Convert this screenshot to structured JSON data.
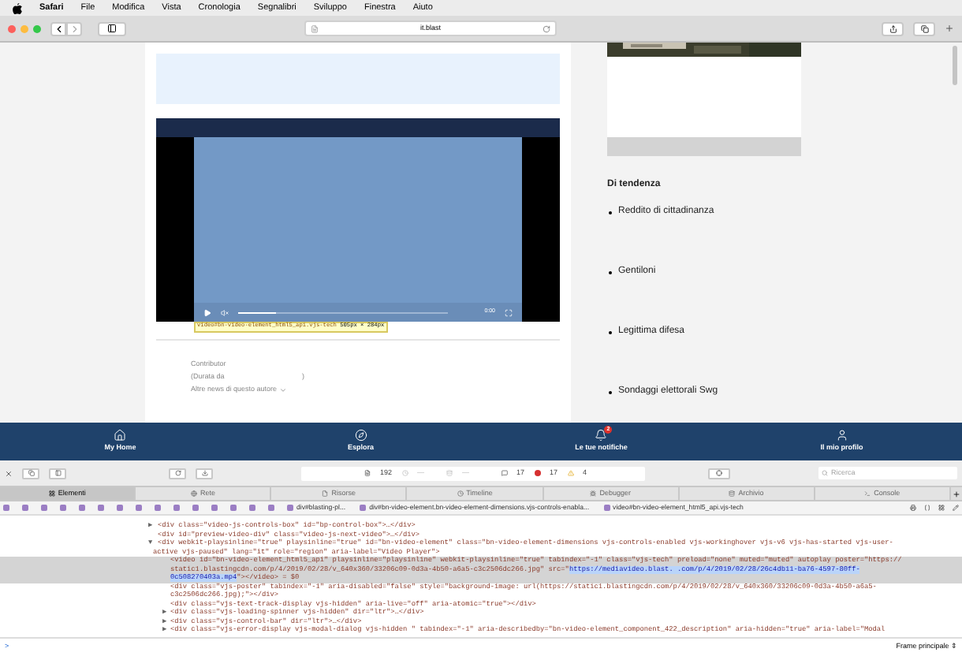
{
  "menu_bar": {
    "app": "Safari",
    "items": [
      "File",
      "Modifica",
      "Vista",
      "Cronologia",
      "Segnalibri",
      "Sviluppo",
      "Finestra",
      "Aiuto"
    ]
  },
  "address_bar": {
    "url": "it.blast"
  },
  "page": {
    "video": {
      "time": "0:00",
      "progress": {
        "level": 0.18
      },
      "inspector_tooltip": {
        "selector": "video#bn-video-element_html5_api.vjs-tech",
        "size": "505px × 284px"
      }
    },
    "author": {
      "label": "Contributor",
      "duration": "(Durata da",
      "duration_end": ")",
      "more": "Altre news di questo autore"
    },
    "trending": {
      "title": "Di tendenza",
      "items": [
        "Reddito di cittadinanza",
        "Gentiloni",
        "Legittima difesa",
        "Sondaggi elettorali Swg"
      ]
    }
  },
  "bottom_nav": [
    {
      "label": "My Home"
    },
    {
      "label": "Esplora"
    },
    {
      "label": "Le tue notifiche",
      "badge": "2"
    },
    {
      "label": "Il mio profilo"
    }
  ],
  "inspector": {
    "toolbar": {
      "resources": "192",
      "load_time": "—",
      "size": "—",
      "messages": "17",
      "errors": "17",
      "warnings": "4",
      "search_placeholder": "Ricerca"
    },
    "tabs": [
      {
        "label": "Elementi",
        "selected": true
      },
      {
        "label": "Rete",
        "selected": false
      },
      {
        "label": "Risorse",
        "selected": false
      },
      {
        "label": "Timeline",
        "selected": false
      },
      {
        "label": "Debugger",
        "selected": false
      },
      {
        "label": "Archivio",
        "selected": false
      },
      {
        "label": "Console",
        "selected": false
      }
    ],
    "breadcrumbs": [
      "div#blasting-pl...",
      "div#bn-video-element.bn-video-element-dimensions.vjs-controls-enabla...",
      "video#bn-video-element_html5_api.vjs-tech"
    ],
    "code_lines": [
      {
        "kind": "child",
        "toggle": "▶",
        "selected": false,
        "segments": [
          {
            "text": "<div class=\"video-js-controls-box\" id=\"bp-control-box\">…</div>",
            "selected": false
          }
        ]
      },
      {
        "kind": "child",
        "selected": false,
        "segments": [
          {
            "text": "<div id=\"preview-video-div\" class=\"video-js-next-video\">…</div>",
            "selected": false
          }
        ]
      },
      {
        "kind": "child",
        "toggle": "▼",
        "selected": false,
        "segments": [
          {
            "text": "<div webkit-playsinline=\"true\" playsinline=\"true\" id=\"bn-video-element\" class=\"bn-video-element-dimensions vjs-controls-enabled vjs-workinghover vjs-v6 vjs-has-started vjs-user-",
            "selected": false
          }
        ]
      },
      {
        "kind": "wrap",
        "selected": false,
        "segments": [
          {
            "text": "active vjs-paused\" lang=\"it\" role=\"region\" aria-label=\"Video Player\">",
            "selected": false
          }
        ]
      },
      {
        "kind": "grandchild",
        "selected": true,
        "segments": [
          {
            "text": "<video id=\"bn-video-element_html5_api\" playsinline=\"playsinline\" webkit-playsinline=\"true\" tabindex=\"-1\" class=\"vjs-tech\" preload=\"none\" muted=\"muted\" autoplay poster=\"https://",
            "selected": false
          }
        ]
      },
      {
        "kind": "grandchild",
        "selected": true,
        "segments": [
          {
            "text": "static1.blastingcdn.com/p/4/2019/02/28/v_640x360/33206c09-0d3a-4b50-a6a5-c3c2506dc266.jpg\" src=\"",
            "selected": false
          },
          {
            "text": "https://mediavideo.blast.      .com/p/4/2019/02/28/26c4db11-ba76-4597-80ff-",
            "selected": true
          }
        ]
      },
      {
        "kind": "grandchild",
        "selected": true,
        "segments": [
          {
            "text": "0c508270403a.mp4",
            "selected": true
          },
          {
            "text": "\"></video> = $0",
            "selected": false
          }
        ]
      },
      {
        "kind": "grandchild",
        "selected": false,
        "segments": [
          {
            "text": "<div class=\"vjs-poster\" tabindex=\"-1\" aria-disabled=\"false\" style=\"background-image: url(https://static1.blastingcdn.com/p/4/2019/02/28/v_640x360/33206c09-0d3a-4b50-a6a5-",
            "selected": false
          }
        ]
      },
      {
        "kind": "grandchild",
        "selected": false,
        "segments": [
          {
            "text": "c3c2506dc266.jpg);\"></div>",
            "selected": false
          }
        ]
      },
      {
        "kind": "grandchild",
        "selected": false,
        "segments": [
          {
            "text": "<div class=\"vjs-text-track-display vjs-hidden\" aria-live=\"off\" aria-atomic=\"true\"></div>",
            "selected": false
          }
        ]
      },
      {
        "kind": "grandchild",
        "toggle": "▶",
        "selected": false,
        "segments": [
          {
            "text": "<div class=\"vjs-loading-spinner vjs-hidden\" dir=\"ltr\">…</div>",
            "selected": false
          }
        ]
      },
      {
        "kind": "grandchild",
        "toggle": "▶",
        "selected": false,
        "segments": [
          {
            "text": "<div class=\"vjs-control-bar\" dir=\"ltr\">…</div>",
            "selected": false
          }
        ]
      },
      {
        "kind": "grandchild",
        "toggle": "▶",
        "selected": false,
        "segments": [
          {
            "text": "<div class=\"vjs-error-display vjs-modal-dialog vjs-hidden \" tabindex=\"-1\" aria-describedby=\"bn-video-element_component_422_description\" aria-hidden=\"true\" aria-label=\"Modal",
            "selected": false
          }
        ]
      }
    ],
    "console": {
      "prompt": ">",
      "frame": "Frame principale ⇕"
    }
  }
}
